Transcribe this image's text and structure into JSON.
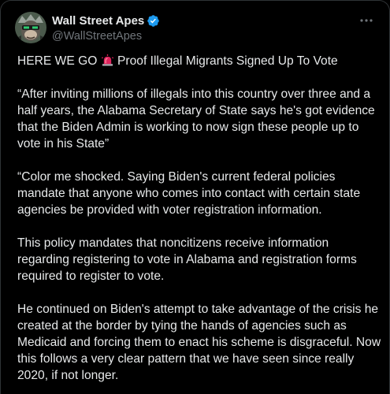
{
  "tweet": {
    "author": {
      "display_name": "Wall Street Apes",
      "handle": "@WallStreetApes",
      "verified": true,
      "avatar_icon": "ape-avatar-icon"
    },
    "menu_icon": "more-options-icon",
    "headline_before": "HERE WE GO ",
    "headline_icon": "police-siren-icon",
    "headline_after": " Proof Illegal Migrants Signed Up To Vote",
    "paragraphs": [
      "“After inviting millions of illegals into this country over three and a half years, the Alabama Secretary of State says he's got evidence that the Biden Admin is working to now sign these people up to vote in his State”",
      "“Color me shocked. Saying Biden's current federal policies mandate that anyone who comes into contact with certain state agencies be provided with voter registration information.",
      "This policy mandates that noncitizens receive information regarding registering to vote in Alabama and registration forms required to register to vote.",
      "He continued on Biden's attempt to take advantage of the crisis he created at the border by tying the hands of agencies such as Medicaid and forcing them to enact his scheme is disgraceful. Now this follows a very clear pattern that we have seen since really 2020, if not longer."
    ]
  },
  "colors": {
    "background": "#000000",
    "text_primary": "#e7e9ea",
    "text_secondary": "#71767b",
    "verified_blue": "#1d9bf0",
    "siren_red": "#e0245e"
  }
}
